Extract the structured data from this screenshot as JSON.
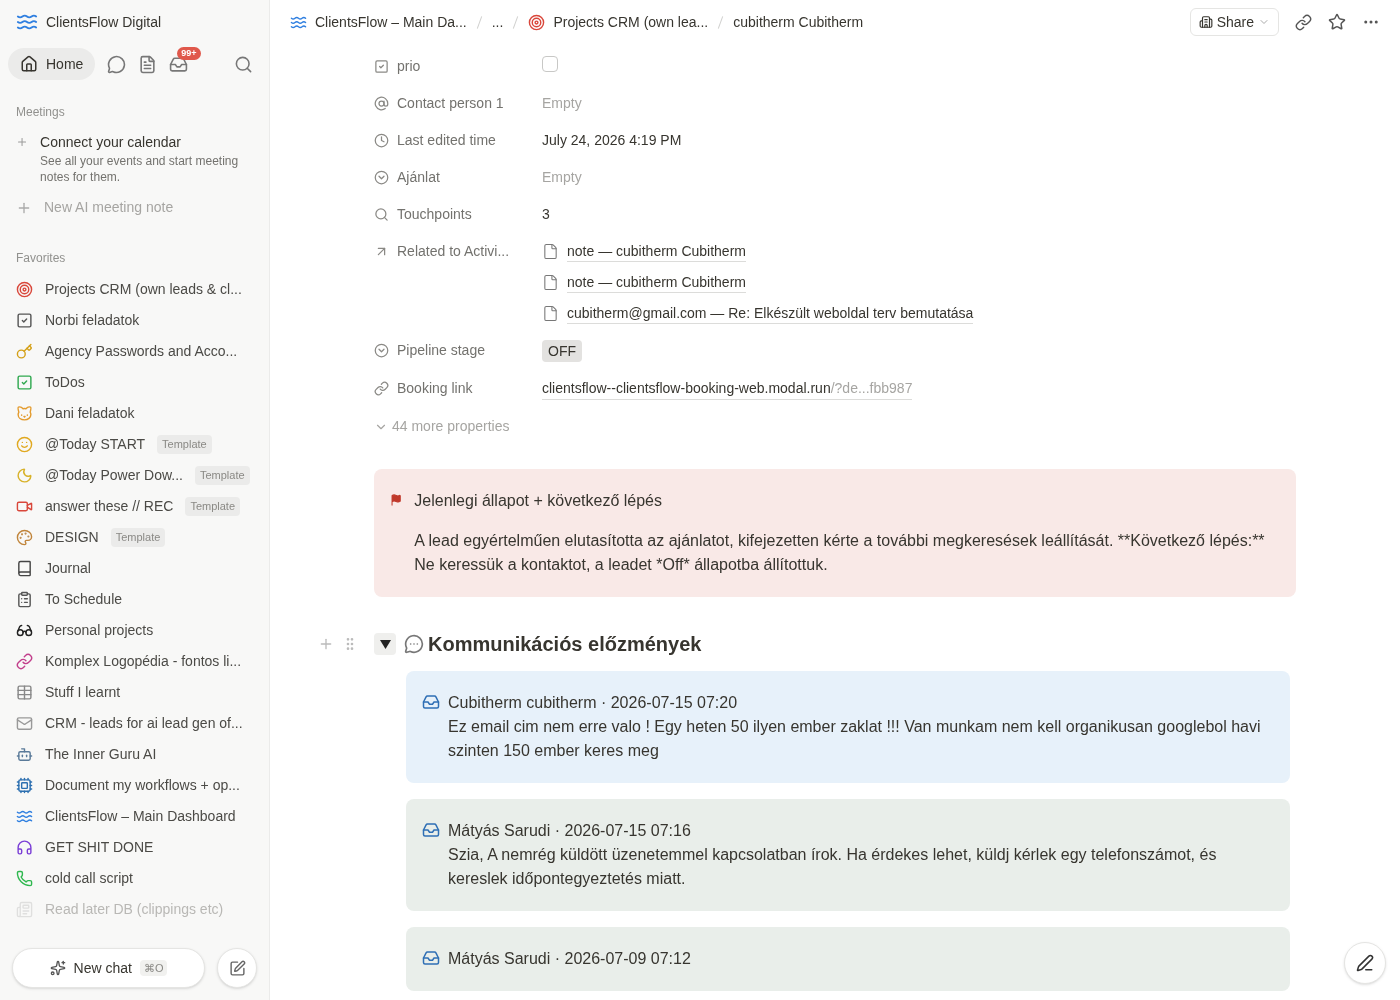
{
  "workspace": {
    "name": "ClientsFlow Digital"
  },
  "nav": {
    "home": {
      "label": "Home",
      "selected": true
    },
    "inbox_badge": "99+"
  },
  "meetings": {
    "heading": "Meetings",
    "connect_title": "Connect your calendar",
    "connect_description": "See all your events and start meeting notes for them.",
    "new_note": "New AI meeting note"
  },
  "favorites": {
    "heading": "Favorites",
    "items": [
      {
        "label": "Projects CRM (own leads & cl...",
        "faded": false
      },
      {
        "label": "Norbi feladatok",
        "faded": false
      },
      {
        "label": "Agency Passwords and Acco...",
        "faded": false
      },
      {
        "label": "ToDos",
        "faded": false
      },
      {
        "label": "Dani feladatok",
        "faded": false
      },
      {
        "label": "@Today START",
        "tag": "Template",
        "faded": false
      },
      {
        "label": "@Today Power Dow...",
        "tag": "Template",
        "faded": false
      },
      {
        "label": "answer these // REC",
        "tag": "Template",
        "faded": false
      },
      {
        "label": "DESIGN",
        "tag": "Template",
        "faded": false
      },
      {
        "label": "Journal",
        "faded": false
      },
      {
        "label": "To Schedule",
        "faded": false
      },
      {
        "label": "Personal projects",
        "faded": false
      },
      {
        "label": "Komplex Logopédia - fontos li...",
        "faded": false
      },
      {
        "label": "Stuff I learnt",
        "faded": false
      },
      {
        "label": "CRM - leads for ai lead gen of...",
        "faded": false
      },
      {
        "label": "The Inner Guru AI",
        "faded": false
      },
      {
        "label": "Document my workflows + op...",
        "faded": false
      },
      {
        "label": "ClientsFlow – Main Dashboard",
        "faded": false
      },
      {
        "label": "GET SHIT DONE",
        "faded": false
      },
      {
        "label": "cold call script",
        "faded": false
      },
      {
        "label": "Read later DB (clippings etc)",
        "faded": true
      }
    ]
  },
  "new_chat": {
    "label": "New chat",
    "shortcut": "⌘O"
  },
  "breadcrumbs": [
    {
      "label": "ClientsFlow – Main Da...",
      "kind": "waves"
    },
    {
      "label": "...",
      "kind": "plain"
    },
    {
      "label": "Projects CRM (own lea...",
      "kind": "target"
    },
    {
      "label": "cubitherm Cubitherm",
      "kind": "plain"
    }
  ],
  "share": "Share",
  "properties": [
    {
      "label": "prio",
      "kind": "checkbox",
      "checked": false
    },
    {
      "label": "Contact person 1",
      "kind": "empty",
      "value": "Empty"
    },
    {
      "label": "Last edited time",
      "kind": "text",
      "value": "July 24, 2026 4:19 PM"
    },
    {
      "label": "Ajánlat",
      "kind": "empty",
      "value": "Empty"
    },
    {
      "label": "Touchpoints",
      "kind": "text",
      "value": "3"
    },
    {
      "label": "Related to Activi...",
      "kind": "relation",
      "items": [
        "note — cubitherm Cubitherm",
        "note — cubitherm Cubitherm",
        "cubitherm@gmail.com — Re: Elkészült weboldal terv bemutatása"
      ]
    },
    {
      "label": "Pipeline stage",
      "kind": "tag",
      "value": "OFF"
    },
    {
      "label": "Booking link",
      "kind": "link",
      "value": "clientsflow--clientsflow-booking-web.modal.run",
      "rest": "/?de...fbb987"
    }
  ],
  "more_properties": "44 more properties",
  "callout": {
    "title": "Jelenlegi állapot + következő lépés",
    "body": "A lead egyértelműen elutasította az ajánlatot, kifejezetten kérte a további megkeresések leállítását. **Következő lépés:** Ne keressük a kontaktot, a leadet *Off* állapotba állítottuk."
  },
  "section": {
    "title": "Kommunikációs előzmények",
    "expanded": true
  },
  "messages": [
    {
      "header": "Cubitherm cubitherm · 2026-07-15 07:20",
      "body": "Ez email cim nem erre valo ! Egy heten 50 ilyen ember zaklat !!! Van munkam nem kell organikusan googlebol havi szinten 150 ember keres meg",
      "color": "#e7f1fa"
    },
    {
      "header": "Mátyás Sarudi · 2026-07-15 07:16",
      "body": "Szia, A nemrég küldött üzenetemmel kapcsolatban írok. Ha érdekes lehet, küldj kérlek egy telefonszámot, és kereslek időpontegyeztetés miatt.",
      "color": "#e9eeea"
    },
    {
      "header": "Mátyás Sarudi · 2026-07-09 07:12",
      "color": "#e9eeea"
    }
  ]
}
